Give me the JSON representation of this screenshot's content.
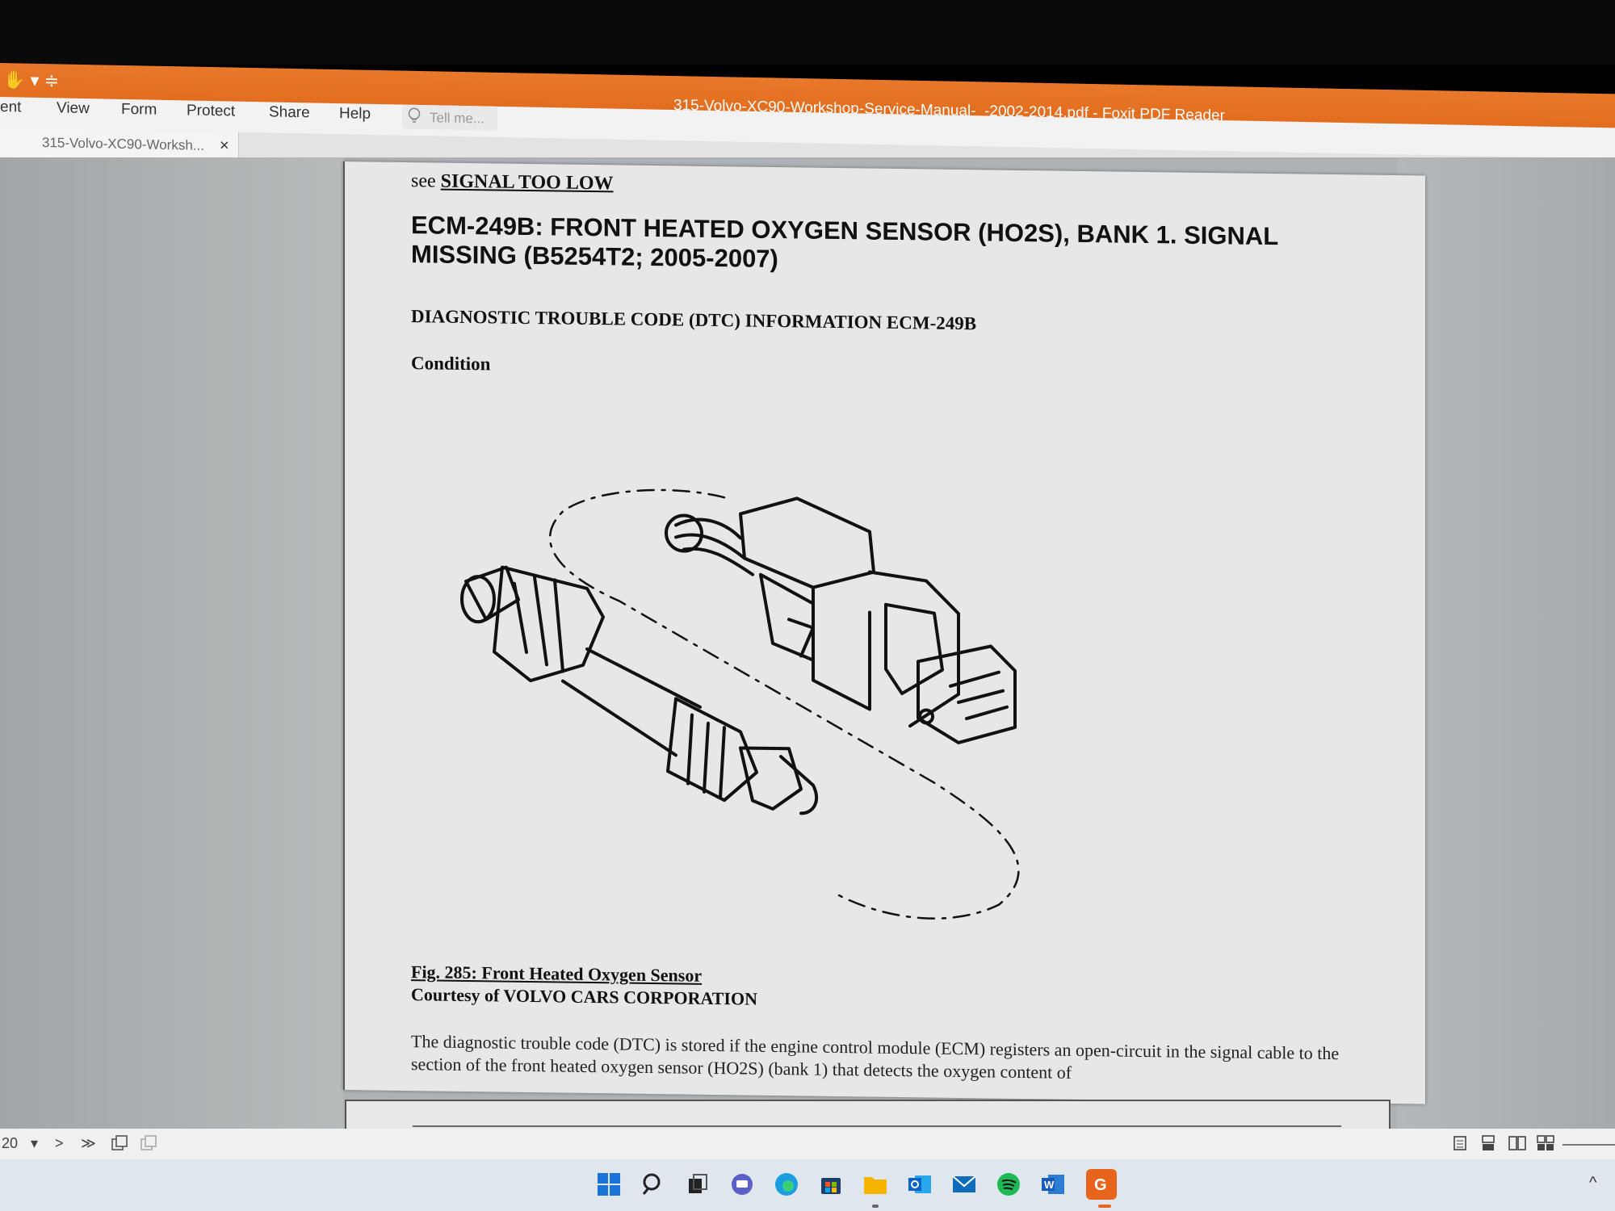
{
  "window": {
    "title": "315-Volvo-XC90-Workshop-Service-Manual-_-2002-2014.pdf - Foxit PDF Reader",
    "quick_access": "✋ ▾ ≑"
  },
  "menu": {
    "items": [
      "ent",
      "View",
      "Form",
      "Protect",
      "Share",
      "Help"
    ],
    "tell_me_placeholder": "Tell me..."
  },
  "tabs": [
    {
      "label": "315-Volvo-XC90-Worksh...",
      "close": "×"
    }
  ],
  "document": {
    "see_prefix": "see",
    "see_link": "SIGNAL TOO LOW",
    "heading": "ECM-249B: FRONT HEATED OXYGEN SENSOR (HO2S), BANK 1. SIGNAL MISSING (B5254T2; 2005-2007)",
    "subheading": "DIAGNOSTIC TROUBLE CODE (DTC) INFORMATION ECM-249B",
    "condition": "Condition",
    "figure_caption": "Fig. 285: Front Heated Oxygen Sensor",
    "courtesy": "Courtesy of VOLVO CARS CORPORATION",
    "paragraph": "The diagnostic trouble code (DTC) is stored if the engine control module (ECM) registers an open-circuit in the signal cable to the section of the front heated oxygen sensor (HO2S) (bank 1) that detects the oxygen content of"
  },
  "statusbar": {
    "page": "20",
    "dropdown": "▾",
    "next": ">",
    "last": "≫"
  },
  "taskbar": {
    "icons": [
      "start-icon",
      "search-icon",
      "task-view-icon",
      "chat-icon",
      "edge-icon",
      "store-icon",
      "file-explorer-icon",
      "outlook-icon",
      "mail-icon",
      "spotify-icon",
      "word-icon",
      "foxit-icon"
    ],
    "caret": "^"
  },
  "colors": {
    "titlebar": "#e26a1c",
    "page": "#e6e7e6",
    "workspace": "#aeb2b4"
  }
}
